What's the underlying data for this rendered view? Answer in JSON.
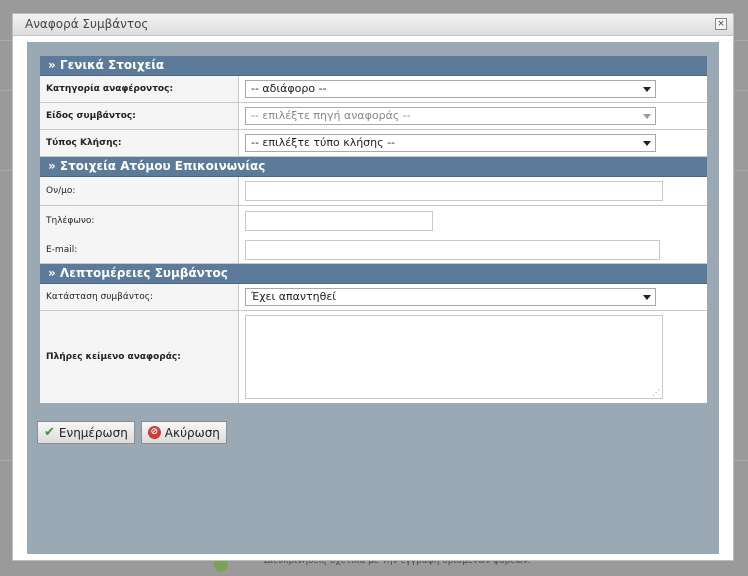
{
  "dialog": {
    "title": "Αναφορά Συμβάντος",
    "close_label": "×"
  },
  "sections": {
    "general": {
      "header": "» Γενικά Στοιχεία",
      "category_label": "Κατηγορία αναφέροντος:",
      "category_value": "-- αδιάφορο --",
      "type_label": "Είδος συμβάντος:",
      "type_value": "-- επιλέξτε πηγή αναφοράς --",
      "call_label": "Τύπος Κλήσης:",
      "call_value": "-- επιλέξτε τύπο κλήσης --"
    },
    "contact": {
      "header": "» Στοιχεία Ατόμου Επικοινωνίας",
      "name_label": "Ον/μο:",
      "name_value": "",
      "phone_label": "Τηλέφωνο:",
      "phone_value": "",
      "email_label": "E-mail:",
      "email_value": ""
    },
    "details": {
      "header": "» Λεπτομέρειες Συμβάντος",
      "status_label": "Κατάσταση συμβάντος:",
      "status_value": "Έχει απαντηθεί",
      "text_label": "Πλήρες κείμενο αναφοράς:",
      "text_value": ""
    }
  },
  "buttons": {
    "update": "Ενημέρωση",
    "cancel": "Ακύρωση"
  },
  "background": {
    "footer_text": "Διευκρινήσεις σχετικά με την εγγραφή ορισμένων φορέων."
  }
}
